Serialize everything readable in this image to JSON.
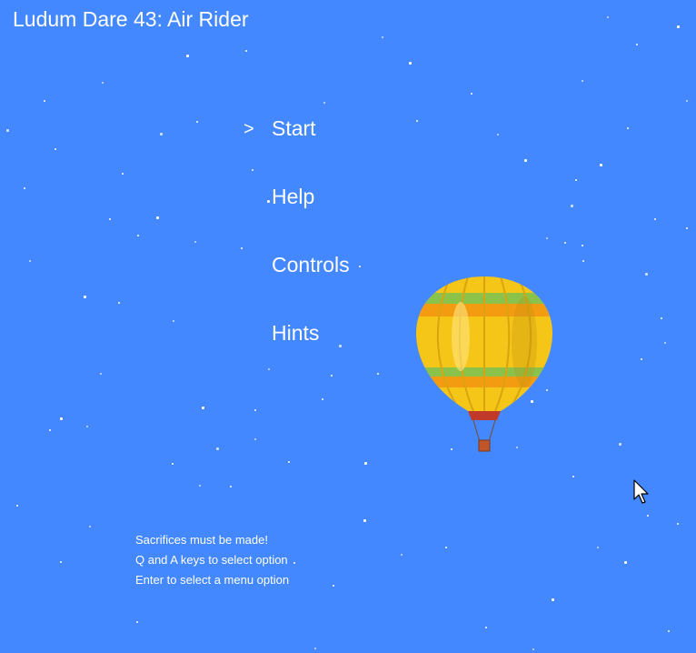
{
  "game": {
    "title": "Ludum Dare 43: Air Rider",
    "background_color": "#4488ff"
  },
  "menu": {
    "cursor_symbol": ">",
    "selected_index": 0,
    "items": [
      {
        "label": "Start"
      },
      {
        "label": "Help"
      },
      {
        "label": "Controls"
      },
      {
        "label": "Hints"
      }
    ]
  },
  "instructions": {
    "lines": [
      "Sacrifices must be made!",
      "Q and A keys to select option",
      "Enter to select a menu option"
    ]
  },
  "sprites": {
    "player": "hot-air-balloon",
    "player_colors": [
      "#f5c518",
      "#f39c12",
      "#8bc34a",
      "#c0392b"
    ],
    "pointer": "mouse-cursor-icon"
  }
}
